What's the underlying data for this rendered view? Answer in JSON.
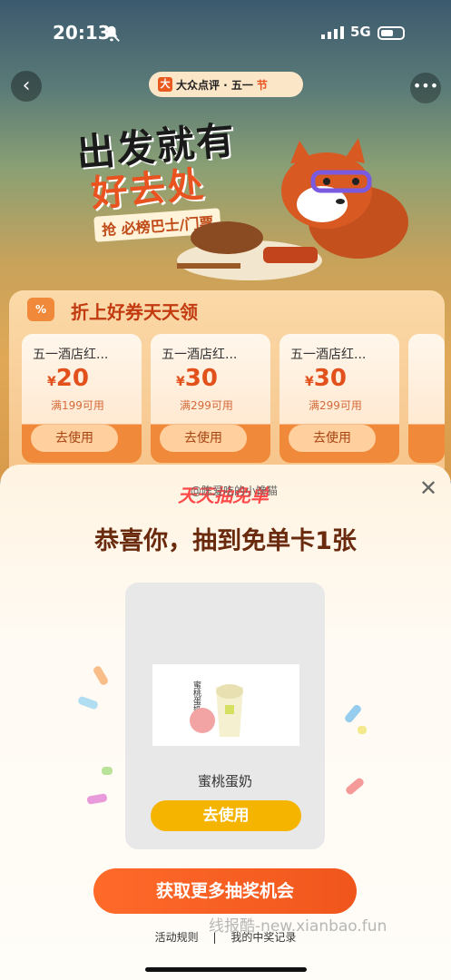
{
  "status": {
    "time": "20:13",
    "network": "5G"
  },
  "banner": {
    "brand": "大众点评 · 五一",
    "brand_badge": "节",
    "headline_line1": "出发就有",
    "headline_line2": "好去处",
    "tagline": "抢 必榜巴士/门票"
  },
  "coupons": {
    "section_badge": "%",
    "section_title": "折上好券天天领",
    "currency": "¥",
    "items": [
      {
        "name": "五一酒店红...",
        "amount": "20",
        "condition": "满199可用",
        "button": "去使用"
      },
      {
        "name": "五一酒店红...",
        "amount": "30",
        "condition": "满299可用",
        "button": "去使用"
      },
      {
        "name": "五一酒店红...",
        "amount": "30",
        "condition": "满299可用",
        "button": "去使用"
      }
    ]
  },
  "sheet": {
    "logo": "天天抽免单",
    "weibo_mark": "@陈爱吃的小馋猫",
    "headline": "恭喜你，抽到免单卡1张",
    "prize": {
      "image_label": "蜜桃蛋奶",
      "name": "蜜桃蛋奶",
      "button": "去使用"
    },
    "more_button": "获取更多抽奖机会",
    "link_rules": "活动规则",
    "link_sep": "|",
    "link_records": "我的中奖记录"
  },
  "watermark": "线报酷-new.xianbao.fun",
  "colors": {
    "accent": "#f0561c",
    "gold": "#f5b400",
    "title": "#6a2a0e"
  }
}
